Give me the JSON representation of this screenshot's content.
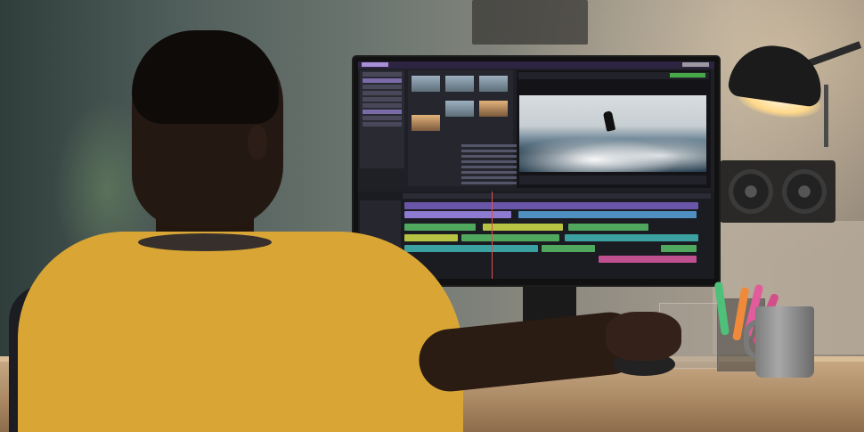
{
  "scene": {
    "description_free": true,
    "colors": {
      "wall_left": "#2f3d3b",
      "wall_right": "#a49a8c",
      "shirt": "#d9a636",
      "desk": "#c9ab86",
      "lamp": "#1b1b1b",
      "lamp_light": "#ffd98a",
      "screen_bg": "#1f1f26",
      "timeline_video": "#6a56a8",
      "timeline_audio": "#4fa85d"
    },
    "icons": {
      "lamp": "desk-lamp-icon",
      "monitor": "monitor-icon"
    }
  }
}
